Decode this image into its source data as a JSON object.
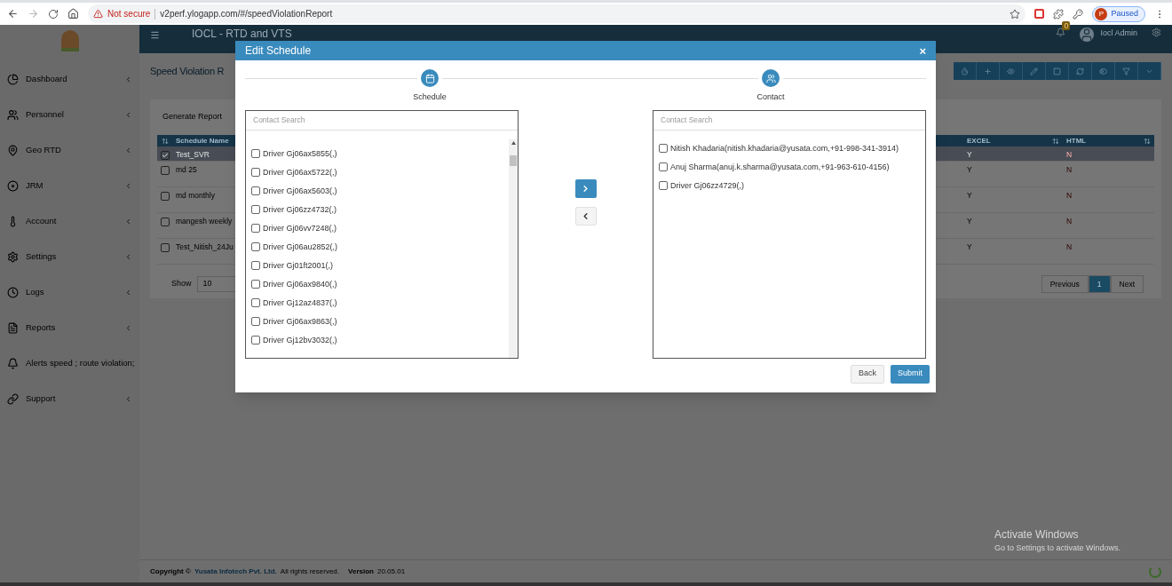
{
  "browser": {
    "security": "Not secure",
    "url": "v2perf.ylogapp.com/#/speedViolationReport",
    "profile_initial": "P",
    "profile_status": "Paused"
  },
  "header": {
    "title": "IOCL - RTD and VTS",
    "notification_count": "0",
    "user": "Iocl Admin"
  },
  "sidebar": {
    "items": [
      {
        "label": "Dashboard",
        "expandable": true
      },
      {
        "label": "Personnel",
        "expandable": true
      },
      {
        "label": "Geo RTD",
        "expandable": true
      },
      {
        "label": "JRM",
        "expandable": true
      },
      {
        "label": "Account",
        "expandable": true
      },
      {
        "label": "Settings",
        "expandable": true
      },
      {
        "label": "Logs",
        "expandable": true
      },
      {
        "label": "Reports",
        "expandable": true
      },
      {
        "label": "Alerts speed ; route violation;",
        "expandable": false
      },
      {
        "label": "Support",
        "expandable": true
      }
    ]
  },
  "page": {
    "title": "Speed Violation R",
    "tab": "Generate Report"
  },
  "table": {
    "columns": [
      "Schedule Name",
      "EXCEL",
      "HTML"
    ],
    "rows": [
      {
        "name": "Test_SVR",
        "checked": true,
        "selected": true,
        "excel": "Y",
        "html": "N"
      },
      {
        "name": "md 25",
        "checked": false,
        "selected": false,
        "excel": "Y",
        "html": "N"
      },
      {
        "name": "md monthly",
        "checked": false,
        "selected": false,
        "excel": "Y",
        "html": "N"
      },
      {
        "name": "mangesh weekly",
        "checked": false,
        "selected": false,
        "excel": "Y",
        "html": "N"
      },
      {
        "name": "Test_Nitish_24Ju",
        "checked": false,
        "selected": false,
        "excel": "Y",
        "html": "N"
      }
    ],
    "show_label": "Show",
    "page_size": "10",
    "pagination": [
      {
        "label": "Previous",
        "selected": false
      },
      {
        "label": "1",
        "selected": true
      },
      {
        "label": "Next",
        "selected": false
      }
    ]
  },
  "modal": {
    "title": "Edit Schedule",
    "close": "×",
    "steps": [
      {
        "label": "Schedule",
        "kind": "calendar"
      },
      {
        "label": "Contact",
        "kind": "users"
      }
    ],
    "available": {
      "placeholder": "Contact Search",
      "items": [
        {
          "label": "Driver Gj06ax5855(,)",
          "checked": false
        },
        {
          "label": "Driver Gj06ax5722(,)",
          "checked": false
        },
        {
          "label": "Driver Gj06ax5603(,)",
          "checked": false
        },
        {
          "label": "Driver Gj06zz4732(,)",
          "checked": false
        },
        {
          "label": "Driver Gj06vv7248(,)",
          "checked": false
        },
        {
          "label": "Driver Gj06au2852(,)",
          "checked": false
        },
        {
          "label": "Driver Gj01ft2001(,)",
          "checked": false
        },
        {
          "label": "Driver Gj06ax9840(,)",
          "checked": false
        },
        {
          "label": "Driver Gj12az4837(,)",
          "checked": false
        },
        {
          "label": "Driver Gj06ax9863(,)",
          "checked": false
        },
        {
          "label": "Driver Gj12bv3032(,)",
          "checked": false
        }
      ]
    },
    "selected": {
      "placeholder": "Contact Search",
      "items": [
        {
          "label": "Nitish Khadaria(nitish.khadaria@yusata.com,+91-998-341-3914)",
          "checked": false
        },
        {
          "label": "Anuj Sharma(anuj.k.sharma@yusata.com,+91-963-610-4156)",
          "checked": false
        },
        {
          "label": "Driver Gj06zz4729(,)",
          "checked": false
        }
      ]
    },
    "buttons": [
      "Back",
      "Submit"
    ]
  },
  "footer": {
    "copyright": "Copyright ©",
    "company": "Yusata Infotech Pvt. Ltd.",
    "rights": "All rights reserved.",
    "version_label": "Version",
    "version": "20.05.01"
  },
  "os_notice": {
    "title": "Activate Windows",
    "subtitle": "Go to Settings to activate Windows."
  }
}
